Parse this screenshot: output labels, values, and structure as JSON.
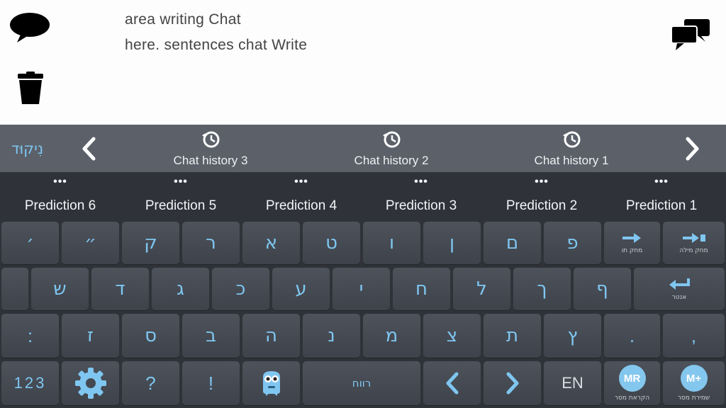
{
  "chat": {
    "line1": "area writing Chat",
    "line2": "here. sentences chat Write"
  },
  "toolbar": {
    "nikud": "נִיקוּד",
    "history": [
      "Chat history 3",
      "Chat history 2",
      "Chat history 1"
    ]
  },
  "predictions": {
    "dots": "•••",
    "items": [
      "Prediction 6",
      "Prediction 5",
      "Prediction 4",
      "Prediction 3",
      "Prediction 2",
      "Prediction 1"
    ]
  },
  "keys": {
    "row1": [
      "׳",
      "״",
      "ק",
      "ר",
      "א",
      "ט",
      "ו",
      "ן",
      "ם",
      "פ"
    ],
    "del_word_label": "מחק מילה",
    "del_letter_label": "מחק תו",
    "row2": [
      "ש",
      "ד",
      "ג",
      "כ",
      "ע",
      "י",
      "ח",
      "ל",
      "ך",
      "ף"
    ],
    "enter_label": "אנטר",
    "row3": [
      ":",
      "ז",
      "ס",
      "ב",
      "ה",
      "נ",
      "מ",
      "צ",
      "ת",
      "ץ",
      ".",
      ","
    ],
    "num_label": "123",
    "question": "?",
    "exclaim": "!",
    "space_label": "רווח",
    "lang_label": "EN",
    "mr_label": "MR",
    "mr_sub": "הקראת מסר",
    "mplus_label": "M+",
    "mplus_sub": "שמירת מסר"
  },
  "colors": {
    "accent": "#7fc6f0",
    "history_bar": "#5b6069",
    "keyboard_bg": "#2f3339"
  }
}
